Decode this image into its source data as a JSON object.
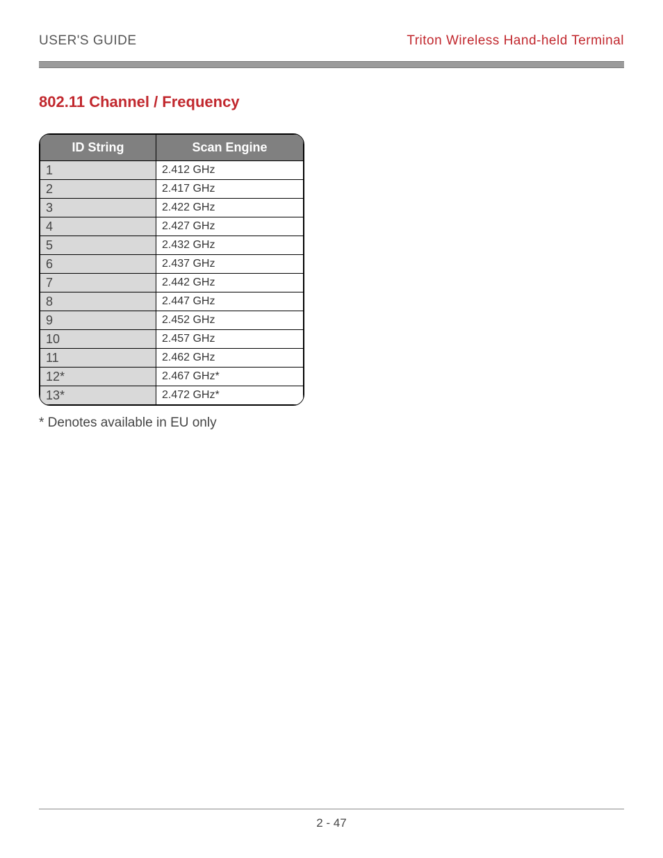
{
  "header": {
    "left": "USER'S GUIDE",
    "right": "Triton Wireless Hand-held Terminal"
  },
  "section_title": "802.11 Channel / Frequency",
  "table": {
    "headers": {
      "col1": "ID String",
      "col2": "Scan Engine"
    },
    "rows": [
      {
        "id": "1",
        "freq": "2.412 GHz"
      },
      {
        "id": "2",
        "freq": "2.417 GHz"
      },
      {
        "id": "3",
        "freq": "2.422 GHz"
      },
      {
        "id": "4",
        "freq": "2.427 GHz"
      },
      {
        "id": "5",
        "freq": "2.432 GHz"
      },
      {
        "id": "6",
        "freq": "2.437 GHz"
      },
      {
        "id": "7",
        "freq": "2.442 GHz"
      },
      {
        "id": "8",
        "freq": "2.447 GHz"
      },
      {
        "id": "9",
        "freq": "2.452 GHz"
      },
      {
        "id": "10",
        "freq": "2.457 GHz"
      },
      {
        "id": "11",
        "freq": "2.462 GHz"
      },
      {
        "id": "12*",
        "freq": "2.467 GHz*"
      },
      {
        "id": "13*",
        "freq": "2.472 GHz*"
      }
    ]
  },
  "footnote": "* Denotes available in EU only",
  "page_number": "2 - 47"
}
